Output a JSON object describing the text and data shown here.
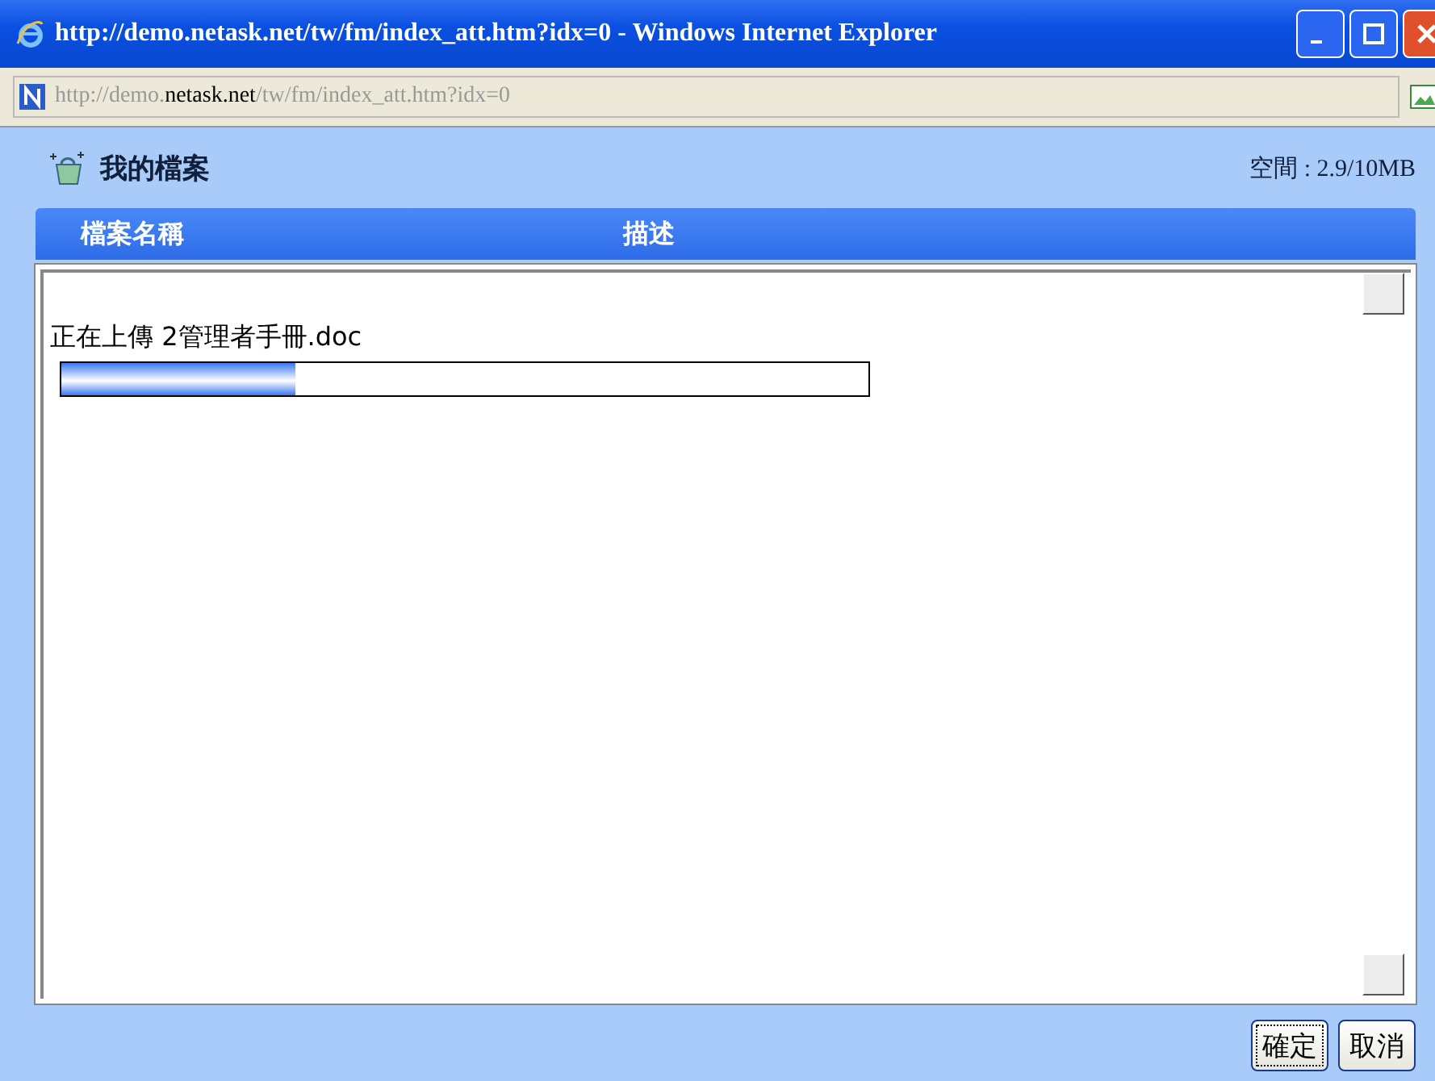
{
  "window": {
    "title": "http://demo.netask.net/tw/fm/index_att.htm?idx=0 - Windows Internet Explorer"
  },
  "address_bar": {
    "segments": [
      {
        "text": "http://demo.",
        "emphasis": false
      },
      {
        "text": "netask.net",
        "emphasis": true
      },
      {
        "text": "/tw/fm/index_att.htm?idx=0",
        "emphasis": false
      }
    ]
  },
  "page": {
    "title": "我的檔案",
    "space": "空間 : 2.9/10MB"
  },
  "columns": [
    "檔案名稱",
    "描述"
  ],
  "upload": {
    "label": "正在上傳 2管理者手冊.doc",
    "level": 0.29
  },
  "buttons": [
    {
      "label": "確定",
      "selected": true
    },
    {
      "label": "取消",
      "selected": false
    }
  ]
}
